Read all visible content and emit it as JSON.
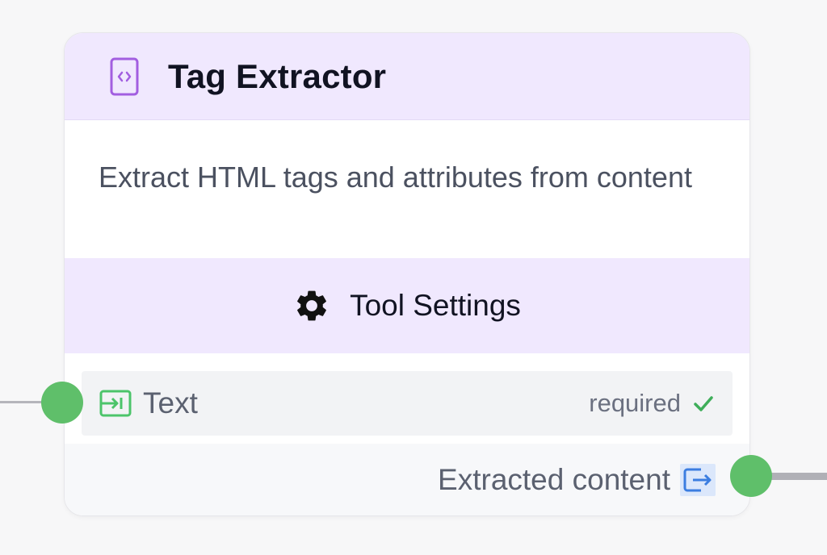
{
  "node": {
    "title": "Tag Extractor",
    "description": "Extract HTML tags and attributes from content",
    "settings_label": "Tool Settings",
    "inputs": [
      {
        "label": "Text",
        "required_text": "required",
        "icon": "input-arrow-icon",
        "status_icon": "check-icon"
      }
    ],
    "outputs": [
      {
        "label": "Extracted content",
        "icon": "output-arrow-icon"
      }
    ]
  },
  "colors": {
    "header_bg": "#f0e8fe",
    "accent_purple": "#9b59d6",
    "handle_green": "#5fbf6a",
    "input_icon_green": "#4cc46a",
    "output_icon_blue": "#3b7de0"
  }
}
